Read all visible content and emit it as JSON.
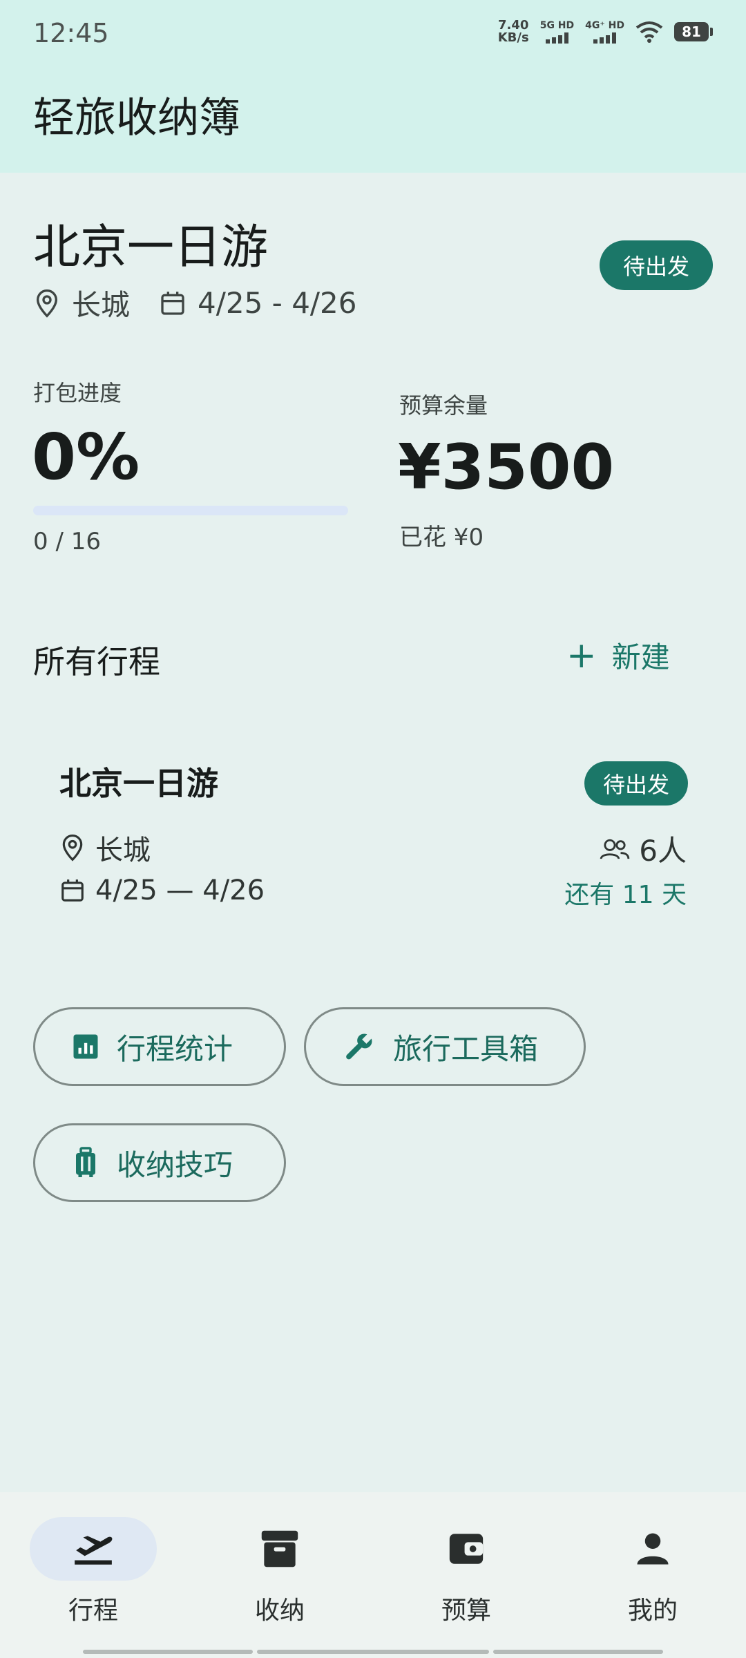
{
  "status_bar": {
    "time": "12:45",
    "net_speed_value": "7.40",
    "net_speed_unit": "KB/s",
    "sim1_label": "5G HD",
    "sim2_label": "4G⁺ HD",
    "battery": "81"
  },
  "app": {
    "title": "轻旅收纳簿"
  },
  "current_trip": {
    "title": "北京一日游",
    "status": "待出发",
    "location": "长城",
    "dates": "4/25 - 4/26"
  },
  "stats": {
    "packing_label": "打包进度",
    "packing_percent": "0%",
    "packing_progress": 0,
    "packing_count": "0 / 16",
    "budget_label": "预算余量",
    "budget_remaining": "¥3500",
    "budget_spent": "已花 ¥0"
  },
  "trips_section": {
    "title": "所有行程",
    "new_label": "新建",
    "trips": [
      {
        "title": "北京一日游",
        "status": "待出发",
        "location": "长城",
        "dates": "4/25 — 4/26",
        "people": "6人",
        "days_left": "还有 11 天"
      }
    ]
  },
  "quick_actions": {
    "stats": "行程统计",
    "toolbox": "旅行工具箱",
    "tips": "收纳技巧"
  },
  "bottom_nav": {
    "trips": "行程",
    "storage": "收纳",
    "budget": "预算",
    "profile": "我的"
  },
  "colors": {
    "accent": "#1b7768",
    "background": "#e6f1ef",
    "header": "#d3f2ec"
  }
}
